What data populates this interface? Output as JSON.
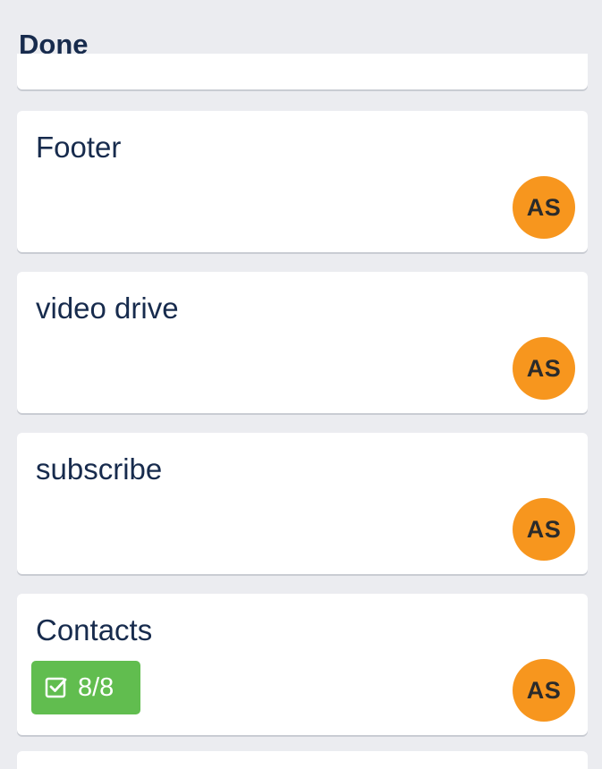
{
  "list": {
    "title": "Done",
    "cards": [
      {
        "title": "Footer",
        "member_initials": "AS",
        "checklist": null
      },
      {
        "title": "video drive",
        "member_initials": "AS",
        "checklist": null
      },
      {
        "title": "subscribe",
        "member_initials": "AS",
        "checklist": null
      },
      {
        "title": "Contacts",
        "member_initials": "AS",
        "checklist": {
          "text": "8/8",
          "icon": "checkbox-checked-icon",
          "color": "#61bd4f"
        }
      }
    ]
  },
  "colors": {
    "list_background": "#ebecf0",
    "card_background": "#ffffff",
    "text": "#172b4d",
    "avatar": "#f7961e",
    "checklist_complete": "#61bd4f"
  }
}
